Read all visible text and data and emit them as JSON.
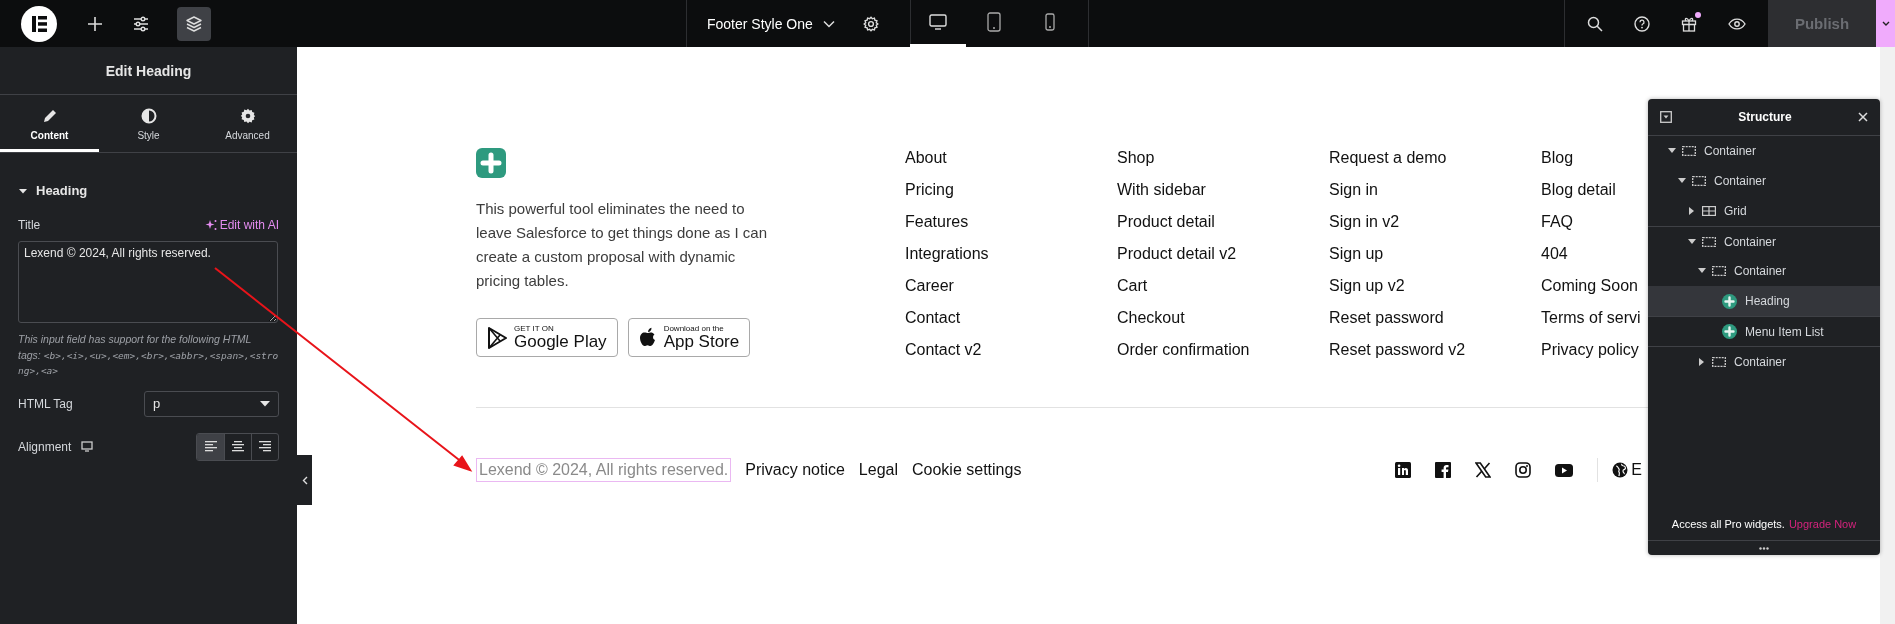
{
  "topbar": {
    "document_title": "Footer Style One",
    "devices": [
      {
        "kind": "desktop",
        "selected": true
      },
      {
        "kind": "tablet",
        "selected": false
      },
      {
        "kind": "mobile",
        "selected": false
      }
    ],
    "gift_has_notification": true,
    "publish": "Publish"
  },
  "panel": {
    "title": "Edit Heading",
    "tabs": [
      {
        "kind": "content",
        "label": "Content",
        "selected": true
      },
      {
        "kind": "style",
        "label": "Style",
        "selected": false
      },
      {
        "kind": "advanced",
        "label": "Advanced",
        "selected": false
      }
    ],
    "section": {
      "title": "Heading",
      "expanded": true
    },
    "title_field": {
      "label": "Title",
      "ai_link": "Edit with AI",
      "value": "Lexend © 2024, All rights reserved."
    },
    "help_text": "This input field has support for the following HTML tags:",
    "help_tags": "<b>,<i>,<u>,<em>,<br>,<abbr>,<span>,<strong>,<a>",
    "html_tag": {
      "label": "HTML Tag",
      "value": "p"
    },
    "alignment": {
      "label": "Alignment",
      "options": [
        {
          "kind": "left",
          "selected": true
        },
        {
          "kind": "center",
          "selected": false
        },
        {
          "kind": "right",
          "selected": false
        }
      ]
    }
  },
  "footer": {
    "description": "This powerful tool eliminates the need to leave Salesforce to get things done as I can create a custom proposal with dynamic pricing tables.",
    "store_buttons": [
      {
        "kind": "google",
        "caption": "GET IT ON",
        "store": "Google Play"
      },
      {
        "kind": "apple",
        "caption": "Download on the",
        "store": "App Store"
      }
    ],
    "link_columns": [
      [
        "About",
        "Pricing",
        "Features",
        "Integrations",
        "Career",
        "Contact",
        "Contact v2"
      ],
      [
        "Shop",
        "With sidebar",
        "Product detail",
        "Product detail v2",
        "Cart",
        "Checkout",
        "Order confirmation"
      ],
      [
        "Request a demo",
        "Sign in",
        "Sign in v2",
        "Sign up",
        "Sign up v2",
        "Reset password",
        "Reset password v2"
      ],
      [
        "Blog",
        "Blog detail",
        "FAQ",
        "404",
        "Coming Soon",
        "Terms of servi",
        "Privacy policy"
      ]
    ],
    "copyright": "Lexend © 2024, All rights reserved.",
    "bottom_links": [
      "Privacy notice",
      "Legal",
      "Cookie settings"
    ],
    "socials": [
      {
        "kind": "linkedin"
      },
      {
        "kind": "facebook"
      },
      {
        "kind": "x"
      },
      {
        "kind": "instagram"
      },
      {
        "kind": "youtube"
      }
    ],
    "language": "E"
  },
  "structure": {
    "title": "Structure",
    "tree": [
      {
        "label": "Container",
        "kind": "container",
        "expanded": true,
        "selected": false,
        "children": [
          {
            "label": "Container",
            "kind": "container",
            "expanded": true,
            "selected": false,
            "children": [
              {
                "label": "Grid",
                "kind": "grid",
                "expanded": false,
                "selected": false
              },
              {
                "label": "Container",
                "kind": "container",
                "expanded": true,
                "selected": false,
                "children": [
                  {
                    "label": "Container",
                    "kind": "container",
                    "expanded": true,
                    "selected": false,
                    "children": [
                      {
                        "label": "Heading",
                        "kind": "widget",
                        "selected": true
                      },
                      {
                        "label": "Menu Item List",
                        "kind": "widget",
                        "selected": false
                      }
                    ]
                  },
                  {
                    "label": "Container",
                    "kind": "container",
                    "expanded": false,
                    "selected": false
                  }
                ]
              }
            ]
          }
        ]
      }
    ],
    "promo_text": "Access all Pro widgets.",
    "promo_link": "Upgrade Now"
  }
}
